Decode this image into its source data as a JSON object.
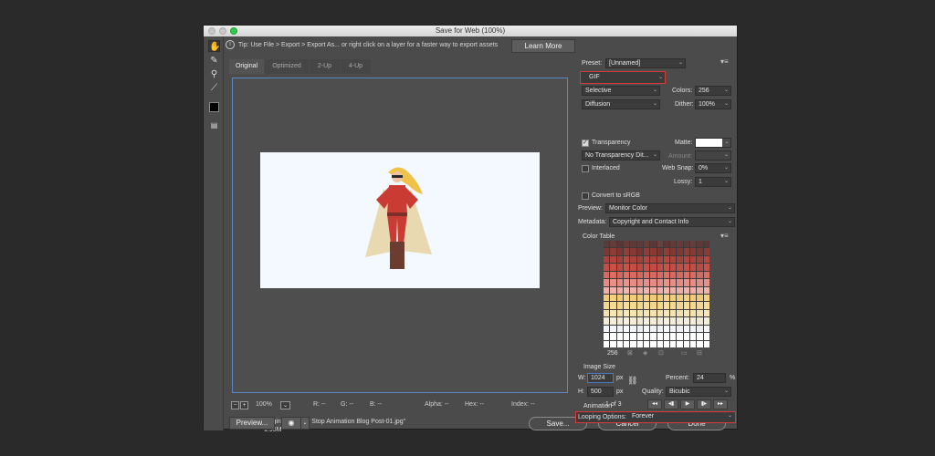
{
  "window": {
    "title": "Save for Web (100%)"
  },
  "tip": {
    "text": "Tip: Use File > Export > Export As...  or right click on a layer for a faster way to export assets",
    "learn_more": "Learn More"
  },
  "tabs": [
    "Original",
    "Optimized",
    "2-Up",
    "4-Up"
  ],
  "image_info": {
    "name": "Original: \"Vector Stop Animation Blog Post-01.jpg\"",
    "size": "1.95M"
  },
  "status": {
    "zoom": "100%",
    "r": "R: --",
    "g": "G: --",
    "b": "B: --",
    "alpha": "Alpha: --",
    "hex": "Hex: --",
    "index": "Index: --"
  },
  "settings": {
    "preset_label": "Preset:",
    "preset_value": "[Unnamed]",
    "format": "GIF",
    "reduction": "Selective",
    "colors_label": "Colors:",
    "colors": "256",
    "dither_algo": "Diffusion",
    "dither_label": "Dither:",
    "dither": "100%",
    "transparency_label": "Transparency",
    "matte_label": "Matte:",
    "transparency_dither": "No Transparency Dit...",
    "amount_label": "Amount:",
    "interlaced_label": "Interlaced",
    "websnap_label": "Web Snap:",
    "websnap": "0%",
    "lossy_label": "Lossy:",
    "lossy": "1",
    "convert_srgb": "Convert to sRGB",
    "preview_label": "Preview:",
    "preview_value": "Monitor Color",
    "metadata_label": "Metadata:",
    "metadata_value": "Copyright and Contact Info"
  },
  "color_table": {
    "title": "Color Table",
    "count": "256"
  },
  "image_size": {
    "title": "Image Size",
    "w_label": "W:",
    "w": "1024",
    "h_label": "H:",
    "h": "500",
    "unit": "px",
    "percent_label": "Percent:",
    "percent": "24",
    "pct": "%",
    "quality_label": "Quality:",
    "quality": "Bicubic"
  },
  "animation": {
    "title": "Animation",
    "looping_label": "Looping Options:",
    "looping": "Forever",
    "frame": "1 of 3"
  },
  "buttons": {
    "preview": "Preview...",
    "save": "Save...",
    "cancel": "Cancel",
    "done": "Done"
  },
  "colors": {
    "table_rows": [
      [
        "#5a3a3a",
        "#643c3c",
        "#5c3434",
        "#6b3a38",
        "#5e3a36",
        "#603a3a",
        "#6a3c3a",
        "#5a3838",
        "#6c3e3e",
        "#5e3434",
        "#623a38",
        "#6a3a3a",
        "#5c3c3a",
        "#683c3c",
        "#603838",
        "#5a3636"
      ],
      [
        "#7a3a34",
        "#8a3c36",
        "#7e3632",
        "#923e38",
        "#843a36",
        "#7c3430",
        "#8e3c38",
        "#883a34",
        "#7a3632",
        "#903e3a",
        "#843834",
        "#7e3a36",
        "#8c3e38",
        "#863a36",
        "#7a3834",
        "#8a3a36"
      ],
      [
        "#a8443c",
        "#b2463e",
        "#a4403a",
        "#b84a40",
        "#ac443e",
        "#a2403a",
        "#b4483e",
        "#aa423c",
        "#a6463e",
        "#b6483e",
        "#ae443c",
        "#a4423c",
        "#b2463e",
        "#ac443c",
        "#a8403a",
        "#b4463e"
      ],
      [
        "#c24e44",
        "#ca5046",
        "#be4a42",
        "#cc5248",
        "#c44e44",
        "#bc4a42",
        "#c85046",
        "#c24c44",
        "#be4e44",
        "#ca5248",
        "#c44c44",
        "#c05046",
        "#ca4e46",
        "#c24e44",
        "#bc4a44",
        "#c85046"
      ],
      [
        "#d86a60",
        "#dc6e64",
        "#d46660",
        "#de7068",
        "#d86c62",
        "#d26860",
        "#dc6e64",
        "#d66a62",
        "#d46c62",
        "#de7066",
        "#d86a62",
        "#d46862",
        "#dc6e66",
        "#d66c62",
        "#d26a60",
        "#dc6e64"
      ],
      [
        "#e68c86",
        "#ea908a",
        "#e48882",
        "#ec928c",
        "#e68e86",
        "#e28a84",
        "#ea908a",
        "#e68c86",
        "#e48a84",
        "#ec928a",
        "#e68e88",
        "#e48a84",
        "#ea9088",
        "#e68c86",
        "#e28a84",
        "#ea908a"
      ],
      [
        "#eeb0a8",
        "#f0b4ac",
        "#ecaca4",
        "#f2b6ae",
        "#eeb2aa",
        "#eaaea6",
        "#f0b4ac",
        "#eeb0a8",
        "#ecaea8",
        "#f2b6ae",
        "#eeb2aa",
        "#ecaea6",
        "#f0b4ac",
        "#eeb0a8",
        "#eaaea6",
        "#f0b4ac"
      ],
      [
        "#f2cc7a",
        "#f4d080",
        "#f0c876",
        "#f6d284",
        "#f2ce7c",
        "#eeca78",
        "#f4d080",
        "#f2cc7a",
        "#f0ca78",
        "#f6d282",
        "#f2ce7c",
        "#f0ca78",
        "#f4d07e",
        "#f2cc7a",
        "#eeca78",
        "#f4d080"
      ],
      [
        "#f4d890",
        "#f6dc96",
        "#f2d48c",
        "#f8de98",
        "#f4da92",
        "#f0d68e",
        "#f6dc96",
        "#f4d890",
        "#f2d68e",
        "#f8de98",
        "#f4da92",
        "#f2d68e",
        "#f6dc94",
        "#f4d890",
        "#f0d68e",
        "#f6dc96"
      ],
      [
        "#f6e2b0",
        "#f8e6b6",
        "#f4deac",
        "#f8e8b8",
        "#f6e4b2",
        "#f2e0ae",
        "#f8e6b6",
        "#f6e2b0",
        "#f4e0ae",
        "#f8e8b8",
        "#f6e4b2",
        "#f4e0ae",
        "#f8e6b4",
        "#f6e2b0",
        "#f2e0ae",
        "#f8e6b6"
      ],
      [
        "#f2ecd8",
        "#f4eedc",
        "#f0ead4",
        "#f6f0de",
        "#f2ecd8",
        "#eee8d2",
        "#f4eedc",
        "#f2ecd8",
        "#f0ead6",
        "#f6f0de",
        "#f2ecda",
        "#f0ead6",
        "#f4eedc",
        "#f2ecd8",
        "#eee8d4",
        "#f4eedc"
      ],
      [
        "#f0f2f6",
        "#f4f6fa",
        "#eef0f4",
        "#f6f8fc",
        "#f2f4f8",
        "#eceef2",
        "#f4f6fa",
        "#f0f2f6",
        "#eef0f4",
        "#f6f8fc",
        "#f2f4f8",
        "#eef0f4",
        "#f4f6fa",
        "#f0f2f6",
        "#eceef2",
        "#f4f6fa"
      ],
      [
        "#ffffff",
        "#ffffff",
        "#ffffff",
        "#ffffff",
        "#ffffff",
        "#ffffff",
        "#ffffff",
        "#ffffff",
        "#ffffff",
        "#ffffff",
        "#ffffff",
        "#ffffff",
        "#ffffff",
        "#ffffff",
        "#ffffff",
        "#ffffff"
      ],
      [
        "#ffffff",
        "#ffffff",
        "#ffffff",
        "#ffffff",
        "#ffffff",
        "#ffffff",
        "#ffffff",
        "#ffffff",
        "#ffffff",
        "#ffffff",
        "#ffffff",
        "#ffffff",
        "#ffffff",
        "#ffffff",
        "#ffffff",
        "#ffffff"
      ]
    ]
  }
}
